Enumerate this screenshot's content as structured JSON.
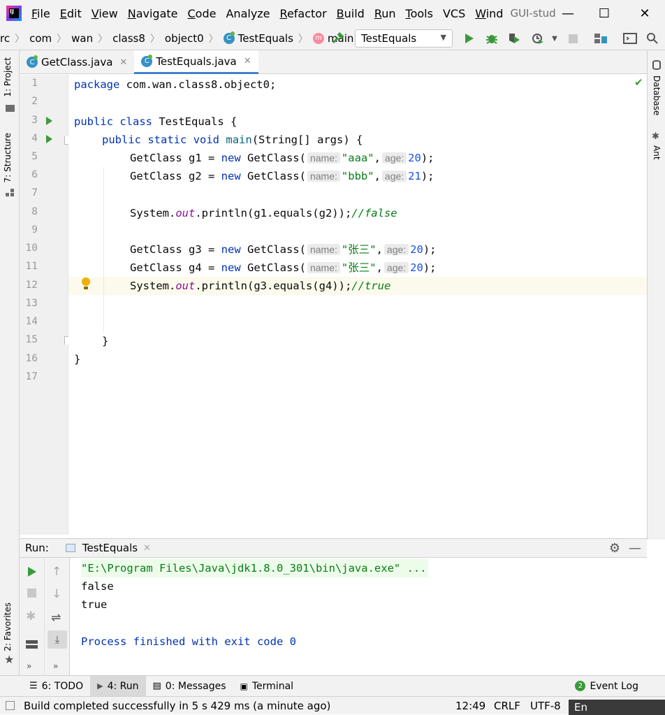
{
  "menu": {
    "items": [
      {
        "label": "File",
        "mnemonic": "F",
        "rest": "ile"
      },
      {
        "label": "Edit",
        "mnemonic": "E",
        "rest": "dit"
      },
      {
        "label": "View",
        "mnemonic": "V",
        "rest": "iew"
      },
      {
        "label": "Navigate",
        "mnemonic": "N",
        "rest": "avigate"
      },
      {
        "label": "Code",
        "mnemonic": "C",
        "rest": "ode"
      },
      {
        "label": "Analyze",
        "mnemonic": "A",
        "rest": "nalyze"
      },
      {
        "label": "Refactor",
        "mnemonic": "R",
        "rest": "efactor"
      },
      {
        "label": "Build",
        "mnemonic": "B",
        "rest": "uild"
      },
      {
        "label": "Run",
        "mnemonic": "R",
        "rest": "un"
      },
      {
        "label": "Tools",
        "mnemonic": "T",
        "rest": "ools"
      },
      {
        "label": "VCS",
        "mnemonic": "V",
        "rest": "CS"
      },
      {
        "label": "Wind",
        "mnemonic": "W",
        "rest": "ind"
      }
    ],
    "window_title": "GUI-stud",
    "app_logo_text": "IJ"
  },
  "window_controls": {
    "minimize": "—",
    "maximize": "☐",
    "close": "✕"
  },
  "breadcrumbs": {
    "items": [
      "rc",
      "com",
      "wan",
      "class8",
      "object0",
      "TestEquals",
      "main"
    ],
    "class_icon": "C",
    "method_icon": "m"
  },
  "run_config": {
    "label": "TestEquals"
  },
  "toolbar_icons": [
    "hammer-icon",
    "run-icon",
    "debug-icon",
    "coverage-icon",
    "profile-icon",
    "stop-icon",
    "project-structure-icon",
    "terminal-icon",
    "search-icon"
  ],
  "left_strip": {
    "project_tab": "1: Project",
    "structure_tab": "7: Structure",
    "favorites_tab": "2: Favorites"
  },
  "right_strip": {
    "database_tab": "Database",
    "ant_tab": "Ant"
  },
  "editor_tabs": [
    {
      "label": "GetClass.java",
      "active": false
    },
    {
      "label": "TestEquals.java",
      "active": true
    }
  ],
  "editor": {
    "line_numbers": [
      "1",
      "2",
      "3",
      "4",
      "5",
      "6",
      "7",
      "8",
      "9",
      "10",
      "11",
      "12",
      "13",
      "14",
      "15",
      "16",
      "17"
    ],
    "current_line": "12",
    "tokens": {
      "package_kw": "package",
      "package_name": " com.wan.class8.object0;",
      "public_kw": "public",
      "class_kw": "class",
      "class_name": " TestEquals {",
      "static_kw": "static",
      "void_kw": "void",
      "main_name": "main",
      "main_args": "(String[] args) {",
      "getclass_type": "GetClass",
      "new_kw": "new",
      "getclass_ctor": " GetClass(",
      "hint_name": "name:",
      "hint_age": "age:",
      "g1_decl": "GetClass g1 = ",
      "g2_decl": "GetClass g2 = ",
      "g3_decl": "GetClass g3 = ",
      "g4_decl": "GetClass g4 = ",
      "str_aaa": "\"aaa\"",
      "str_bbb": "\"bbb\"",
      "str_zs": "\"张三\"",
      "num_20": "20",
      "num_21": "21",
      "comma": ",",
      "close_paren": ");",
      "system": "System.",
      "out": "out",
      "println1": ".println(g1.equals(g2));",
      "println2": ".println(g3.equals(g4));",
      "comment_false": "//false",
      "comment_true": "//true",
      "close_brace": "}",
      "close_brace_inner": "}"
    }
  },
  "run_panel": {
    "label": "Run:",
    "tab_label": "TestEquals",
    "console": [
      "\"E:\\Program Files\\Java\\jdk1.8.0_301\\bin\\java.exe\" ...",
      "false",
      "true",
      "",
      "Process finished with exit code 0"
    ]
  },
  "bottom_tabs": [
    {
      "label": "6: TODO",
      "icon": "todo-icon"
    },
    {
      "label": "4: Run",
      "icon": "run-icon",
      "active": true
    },
    {
      "label": "0: Messages",
      "icon": "messages-icon"
    },
    {
      "label": "Terminal",
      "icon": "terminal-icon"
    }
  ],
  "event_log": {
    "label": "Event Log",
    "count": "2"
  },
  "status": {
    "message": "Build completed successfully in 5 s 429 ms (a minute ago)",
    "position": "12:49",
    "line_sep": "CRLF",
    "encoding": "UTF-8",
    "ime_badge": "En"
  },
  "colors": {
    "keyword": "#0033b3",
    "string": "#067d17",
    "number": "#1750eb",
    "field": "#871094",
    "caret_line": "#fcfaed",
    "accent": "#4083c9"
  }
}
